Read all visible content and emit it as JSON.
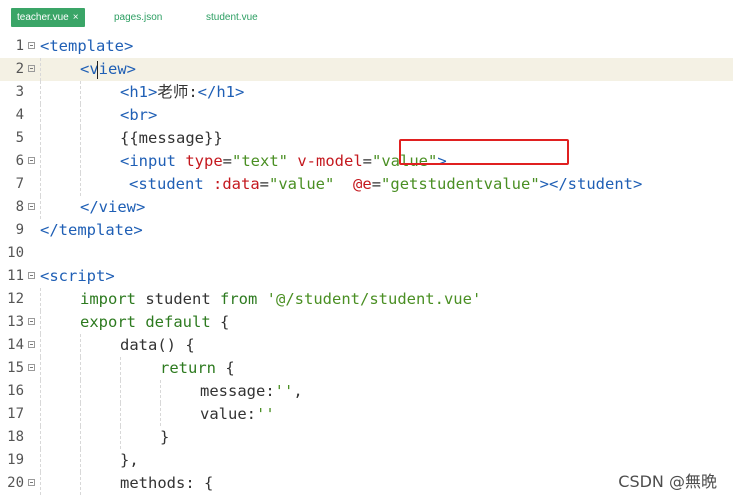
{
  "tabs": [
    {
      "label": "teacher.vue",
      "close": "×"
    },
    {
      "label": "pages.json"
    },
    {
      "label": "student.vue"
    }
  ],
  "lines": [
    {
      "n": "1",
      "fold": true,
      "indent": 0,
      "tokens": [
        {
          "c": "tg",
          "t": "<template>"
        }
      ]
    },
    {
      "n": "2",
      "fold": true,
      "indent": 1,
      "current": true,
      "tokens": [
        {
          "c": "tg",
          "t": "<view>"
        }
      ]
    },
    {
      "n": "3",
      "indent": 2,
      "tokens": [
        {
          "c": "tg",
          "t": "<h1>"
        },
        {
          "c": "tx",
          "t": "老师:"
        },
        {
          "c": "tg",
          "t": "</h1>"
        }
      ]
    },
    {
      "n": "4",
      "indent": 2,
      "tokens": [
        {
          "c": "tg",
          "t": "<br>"
        }
      ]
    },
    {
      "n": "5",
      "indent": 2,
      "tokens": [
        {
          "c": "tx",
          "t": "{{message}}"
        }
      ]
    },
    {
      "n": "6",
      "fold": true,
      "indent": 2,
      "tokens": [
        {
          "c": "tg",
          "t": "<input "
        },
        {
          "c": "at",
          "t": "type"
        },
        {
          "c": "tx",
          "t": "="
        },
        {
          "c": "st",
          "t": "\"text\""
        },
        {
          "c": "tx",
          "t": " "
        },
        {
          "c": "at",
          "t": "v-model"
        },
        {
          "c": "tx",
          "t": "="
        },
        {
          "c": "st",
          "t": "\"value\""
        },
        {
          "c": "tg",
          "t": ">"
        }
      ]
    },
    {
      "n": "7",
      "indent": 2,
      "extra": 1,
      "tokens": [
        {
          "c": "tg",
          "t": "<student "
        },
        {
          "c": "at",
          "t": ":data"
        },
        {
          "c": "tx",
          "t": "="
        },
        {
          "c": "st",
          "t": "\"value\""
        },
        {
          "c": "tx",
          "t": "  "
        },
        {
          "c": "at",
          "t": "@e"
        },
        {
          "c": "tx",
          "t": "="
        },
        {
          "c": "st",
          "t": "\"getstudentvalue\""
        },
        {
          "c": "tg",
          "t": "></student>"
        }
      ]
    },
    {
      "n": "8",
      "fold": true,
      "indent": 1,
      "tokens": [
        {
          "c": "tg",
          "t": "</view>"
        }
      ]
    },
    {
      "n": "9",
      "indent": 0,
      "tokens": [
        {
          "c": "tg",
          "t": "</template>"
        }
      ]
    },
    {
      "n": "10",
      "indent": 0,
      "tokens": []
    },
    {
      "n": "11",
      "fold": true,
      "indent": 0,
      "tokens": [
        {
          "c": "tg",
          "t": "<script>"
        }
      ]
    },
    {
      "n": "12",
      "indent": 1,
      "tokens": [
        {
          "c": "kw",
          "t": "import"
        },
        {
          "c": "tx",
          "t": " student "
        },
        {
          "c": "kw",
          "t": "from"
        },
        {
          "c": "tx",
          "t": " "
        },
        {
          "c": "st",
          "t": "'@/student/student.vue'"
        }
      ]
    },
    {
      "n": "13",
      "fold": true,
      "indent": 1,
      "tokens": [
        {
          "c": "kw",
          "t": "export default"
        },
        {
          "c": "tx",
          "t": " {"
        }
      ]
    },
    {
      "n": "14",
      "fold": true,
      "indent": 2,
      "tokens": [
        {
          "c": "tx",
          "t": "data() {"
        }
      ]
    },
    {
      "n": "15",
      "fold": true,
      "indent": 3,
      "tokens": [
        {
          "c": "kw",
          "t": "return"
        },
        {
          "c": "tx",
          "t": " {"
        }
      ]
    },
    {
      "n": "16",
      "indent": 4,
      "tokens": [
        {
          "c": "tx",
          "t": "message:"
        },
        {
          "c": "st",
          "t": "''"
        },
        {
          "c": "tx",
          "t": ","
        }
      ]
    },
    {
      "n": "17",
      "indent": 4,
      "tokens": [
        {
          "c": "tx",
          "t": "value:"
        },
        {
          "c": "st",
          "t": "''"
        }
      ]
    },
    {
      "n": "18",
      "indent": 3,
      "tokens": [
        {
          "c": "tx",
          "t": "}"
        }
      ]
    },
    {
      "n": "19",
      "indent": 2,
      "tokens": [
        {
          "c": "tx",
          "t": "},"
        }
      ]
    },
    {
      "n": "20",
      "fold": true,
      "indent": 2,
      "tokens": [
        {
          "c": "tx",
          "t": "methods: {"
        }
      ]
    }
  ],
  "watermark": "CSDN @無晩"
}
